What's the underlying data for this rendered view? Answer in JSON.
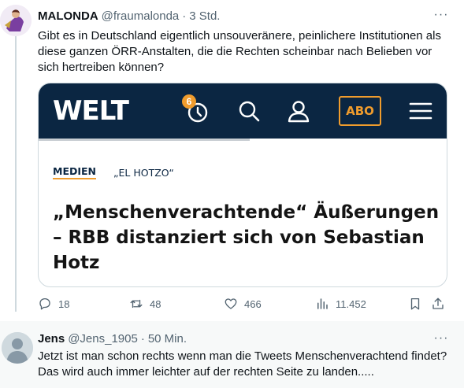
{
  "tweet1": {
    "name": "MALONDA",
    "handle": "@fraumalonda",
    "time": "3 Std.",
    "more": "···",
    "text": "Gibt es in Deutschland eigentlich unsouveränere, peinlichere Institutionen als diese ganzen ÖRR-Anstalten, die die Rechten scheinbar nach Belieben vor sich hertreiben können?",
    "card": {
      "logo": "WELT",
      "badge": "6",
      "abo": "ABO",
      "kicker_category": "MEDIEN",
      "kicker_topic": "„EL HOTZO“",
      "headline": "„Menschenverachtende“ Äußerungen – RBB distanziert sich von Sebastian Hotz"
    },
    "actions": {
      "replies": "18",
      "retweets": "48",
      "likes": "466",
      "views": "11.452"
    }
  },
  "tweet2": {
    "name": "Jens",
    "handle": "@Jens_1905",
    "time": "50 Min.",
    "more": "···",
    "text": "Jetzt ist man schon rechts wenn man die Tweets Menschenverachtend findet? Das wird auch immer leichter auf der rechten Seite zu landen....."
  },
  "colors": {
    "welt_navy": "#0b2642",
    "welt_orange": "#f09c2d",
    "muted_text": "#536471"
  }
}
